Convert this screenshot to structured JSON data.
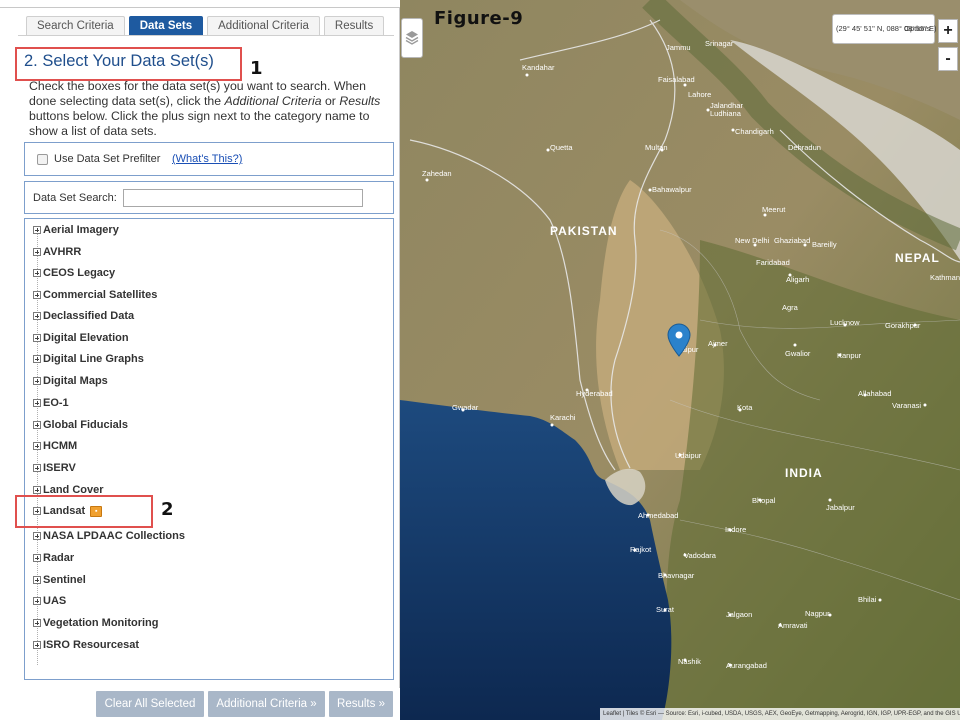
{
  "tabs": [
    {
      "label": "Search Criteria",
      "active": false
    },
    {
      "label": "Data Sets",
      "active": true
    },
    {
      "label": "Additional Criteria",
      "active": false
    },
    {
      "label": "Results",
      "active": false
    }
  ],
  "step_title": "2. Select Your Data Set(s)",
  "markers": {
    "one": "1",
    "two": "2"
  },
  "figure_label": "Figure-9",
  "instructions": {
    "part1": "Check the boxes for the data set(s) you want to search. When done selecting data set(s), click the ",
    "em1": "Additional Criteria",
    "part2": " or ",
    "em2": "Results",
    "part3": " buttons below. Click the plus sign next to the category name to show a list of data sets."
  },
  "prefilter": {
    "label": "Use Data Set Prefilter",
    "link": "(What's This?)",
    "checked": false
  },
  "search": {
    "label": "Data Set Search:",
    "value": ""
  },
  "datasets": [
    {
      "label": "Aerial Imagery"
    },
    {
      "label": "AVHRR"
    },
    {
      "label": "CEOS Legacy"
    },
    {
      "label": "Commercial Satellites"
    },
    {
      "label": "Declassified Data"
    },
    {
      "label": "Digital Elevation"
    },
    {
      "label": "Digital Line Graphs"
    },
    {
      "label": "Digital Maps"
    },
    {
      "label": "EO-1"
    },
    {
      "label": "Global Fiducials"
    },
    {
      "label": "HCMM"
    },
    {
      "label": "ISERV"
    },
    {
      "label": "Land Cover"
    },
    {
      "label": "Landsat",
      "badge": true
    },
    {
      "label": "NASA LPDAAC Collections"
    },
    {
      "label": "Radar"
    },
    {
      "label": "Sentinel"
    },
    {
      "label": "UAS"
    },
    {
      "label": "Vegetation Monitoring"
    },
    {
      "label": "ISRO Resourcesat"
    }
  ],
  "buttons": {
    "clear": "Clear All Selected",
    "additional": "Additional Criteria »",
    "results": "Results »"
  },
  "map": {
    "coordinates": "(29° 45' 51\" N, 088° 08' 55\" E)",
    "options": "Options",
    "zoom_in": "+",
    "zoom_out": "-",
    "attribution": "Leaflet | Tiles © Esri — Source: Esri, i-cubed, USDA, USGS, AEX, GeoEye, Getmapping, Aerogrid, IGN, IGP, UPR-EGP, and the GIS User Community, ESRI",
    "countries": [
      "PAKISTAN",
      "NEPAL",
      "INDIA"
    ],
    "cities": [
      "Kandahar",
      "Quetta",
      "Zahedan",
      "Faisalabad",
      "Jalandhar",
      "Ludhiana",
      "Chandigarh",
      "Dehradun",
      "Lahore",
      "Multan",
      "Bahawalpur",
      "Meerut",
      "New Delhi",
      "Ghaziabad",
      "Faridabad",
      "Bareilly",
      "Aligarh",
      "Agra",
      "Lucknow",
      "Gorakhpur",
      "Jaipur",
      "Ajmer",
      "Gwalior",
      "Kanpur",
      "Hyderabad",
      "Karachi",
      "Gwadar",
      "Udaipur",
      "Allahabad",
      "Varanasi",
      "Kota",
      "Bhopal",
      "Jabalpur",
      "Ahmedabad",
      "Indore",
      "Rajkot",
      "Vadodara",
      "Bhavnagar",
      "Surat",
      "Nashik",
      "Aurangabad",
      "Amravati",
      "Nagpur",
      "Bhilai",
      "Jalgaon",
      "Kathmandu",
      "Jammu",
      "Srinagar"
    ]
  },
  "colors": {
    "tab_active": "#1e5aa0",
    "title_blue": "#1f4e8c",
    "highlight_red": "#e0504e",
    "button_disabled": "#a9b7c8",
    "marker_blue": "#2b82cb"
  }
}
